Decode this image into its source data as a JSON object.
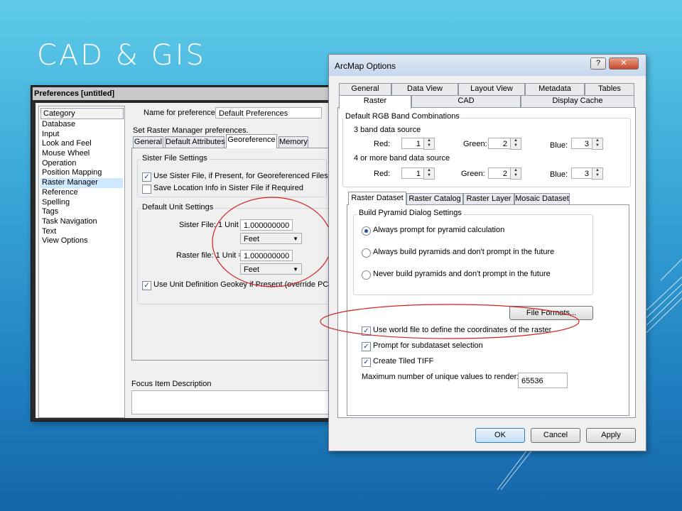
{
  "slide": {
    "title": "CAD & GIS"
  },
  "preferences": {
    "title": "Preferences [untitled]",
    "category_header": "Category",
    "categories": [
      "Database",
      "Input",
      "Look and Feel",
      "Mouse Wheel",
      "Operation",
      "Position Mapping",
      "Raster Manager",
      "Reference",
      "Spelling",
      "Tags",
      "Task Navigation",
      "Text",
      "View Options"
    ],
    "selected_category": "Raster Manager",
    "name_label": "Name for preferences",
    "name_value": "Default Preferences",
    "set_label": "Set Raster Manager preferences.",
    "tabs": [
      "General",
      "Default Attributes",
      "Georeference",
      "Memory"
    ],
    "active_tab": "Georeference",
    "sister_group": "Sister File Settings",
    "use_sister": "Use Sister File, if Present, for Georeferenced Files",
    "save_location": "Save Location Info in Sister File if Required",
    "unit_group": "Default Unit Settings",
    "sister_unit_label": "Sister File: 1 Unit =",
    "sister_unit_value": "1.000000000",
    "sister_unit_select": "Feet",
    "raster_unit_label": "Raster file: 1 Unit =",
    "raster_unit_value": "1.000000000",
    "raster_unit_select": "Feet",
    "use_unit_def": "Use Unit Definition Geokey if Present (override PCS unit)",
    "focus_label": "Focus Item Description"
  },
  "arcmap": {
    "title": "ArcMap Options",
    "help": "?",
    "close": "✕",
    "tabs_row1": [
      "General",
      "Data View",
      "Layout View",
      "Metadata",
      "Tables"
    ],
    "tabs_row2": [
      "Raster",
      "CAD",
      "Display Cache"
    ],
    "active_tab": "Raster",
    "rgb_group": "Default RGB Band Combinations",
    "three_band": "3 band data source",
    "four_band": "4 or more band data source",
    "red_label": "Red:",
    "green_label": "Green:",
    "blue_label": "Blue:",
    "band3": {
      "red": "1",
      "green": "2",
      "blue": "3"
    },
    "band4": {
      "red": "1",
      "green": "2",
      "blue": "3"
    },
    "subtabs": [
      "Raster Dataset",
      "Raster Catalog",
      "Raster Layer",
      "Mosaic Dataset"
    ],
    "active_subtab": "Raster Dataset",
    "pyramid_group": "Build Pyramid Dialog Settings",
    "pyr_opt1": "Always prompt for pyramid calculation",
    "pyr_opt2": "Always build pyramids and don't prompt in the future",
    "pyr_opt3": "Never build pyramids and don't prompt in the future",
    "file_formats": "File Formats...",
    "world_file": "Use world file to define the coordinates of the raster",
    "prompt_subdataset": "Prompt for subdataset selection",
    "tiled_tiff": "Create Tiled TIFF",
    "max_unique_label": "Maximum number of unique values to render:",
    "max_unique_value": "65536",
    "ok": "OK",
    "cancel": "Cancel",
    "apply": "Apply"
  },
  "colors": {
    "highlight_ellipse": "#d42020",
    "selection": "#cde8ff"
  }
}
